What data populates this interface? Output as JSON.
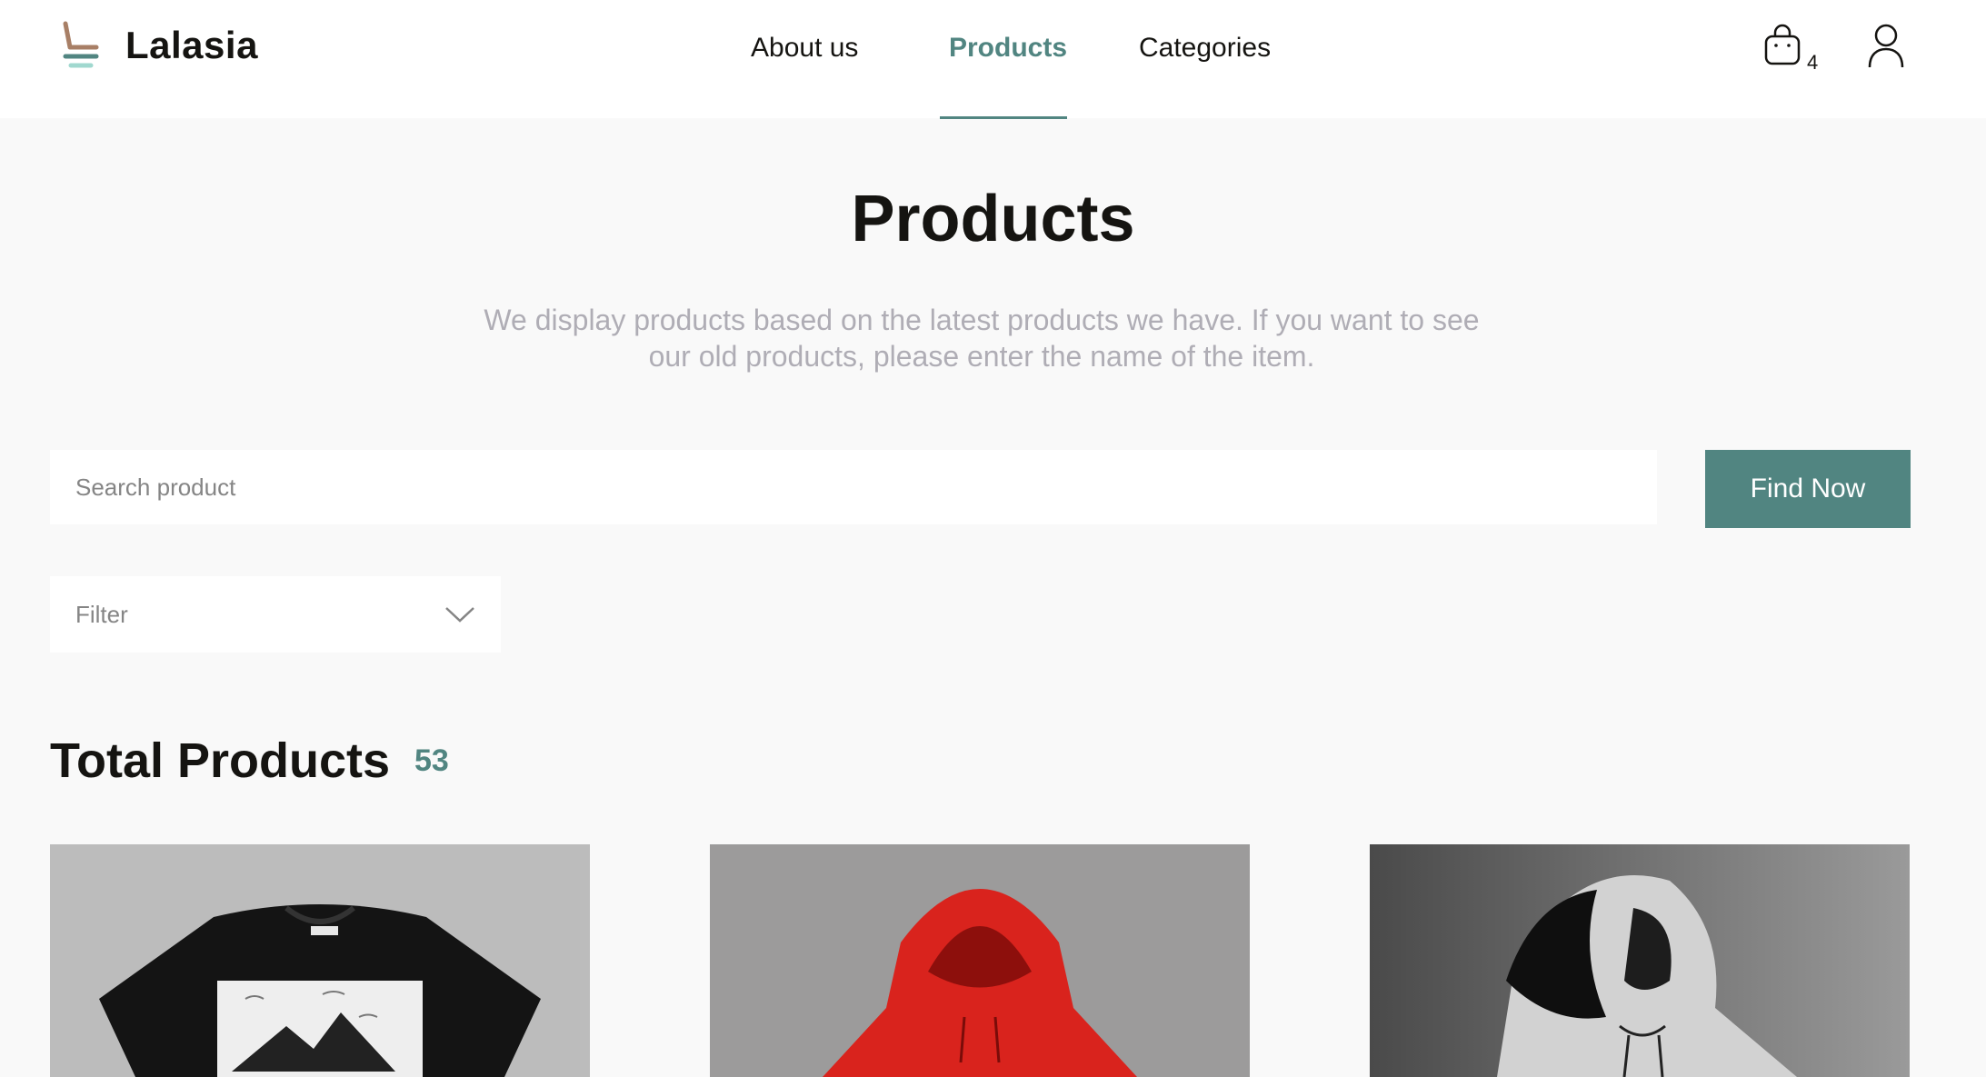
{
  "header": {
    "brand": "Lalasia",
    "nav": [
      {
        "label": "About us",
        "active": false
      },
      {
        "label": "Products",
        "active": true
      },
      {
        "label": "Categories",
        "active": false
      }
    ],
    "cart_count": "4",
    "accent_color": "#518581"
  },
  "main": {
    "title": "Products",
    "description": "We display products based on the latest products we have. If you want to see our old products, please enter the name of the item.",
    "search": {
      "placeholder": "Search product",
      "value": "",
      "button_label": "Find Now"
    },
    "filter": {
      "label": "Filter"
    },
    "total": {
      "label": "Total Products",
      "count": "53"
    },
    "products": [
      {
        "name": "black graphic t-shirt",
        "icon": "tshirt-image"
      },
      {
        "name": "red hoodie",
        "icon": "hoodie-image"
      },
      {
        "name": "grey hoodie",
        "icon": "hoodie-image"
      }
    ]
  },
  "icons": {
    "logo": "chair-logo-icon",
    "cart": "shopping-bag-icon",
    "user": "user-icon",
    "filter": "chevron-down-icon"
  }
}
